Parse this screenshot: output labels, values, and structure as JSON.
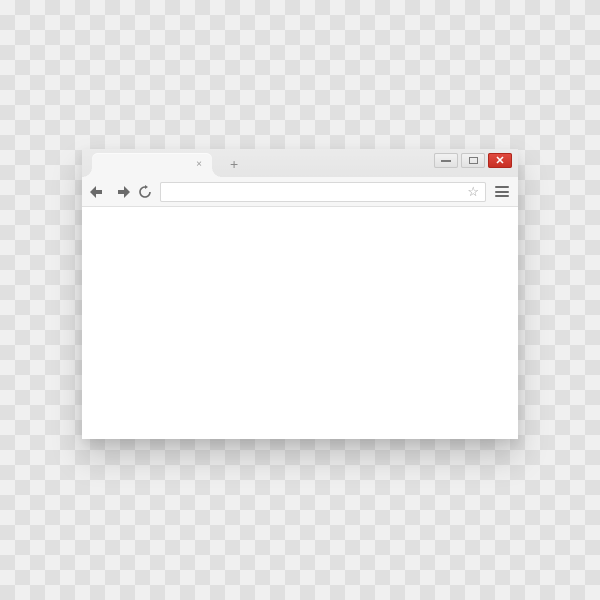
{
  "window": {
    "close_glyph": "✕"
  },
  "tab": {
    "close_glyph": "×"
  },
  "newtab": {
    "glyph": "+"
  },
  "address": {
    "value": "",
    "placeholder": ""
  },
  "bookmark": {
    "glyph": "☆"
  }
}
